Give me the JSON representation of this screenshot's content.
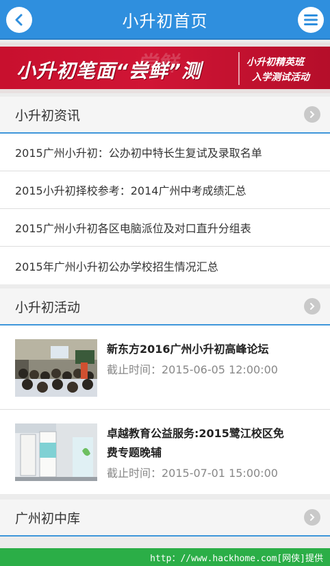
{
  "header": {
    "title": "小升初首页",
    "back_icon": "chevron-left-icon",
    "menu_icon": "menu-icon"
  },
  "banner": {
    "main_text": "小升初笔面“尝鲜”测",
    "ghost_text": "尝鲜",
    "sub_line1": "小升初精英班",
    "sub_line2": "入学测试活动"
  },
  "news": {
    "title": "小升初资讯",
    "items": [
      "2015广州小升初：公办初中特长生复试及录取名单",
      "2015小升初择校参考：2014广州中考成绩汇总",
      "2015广州小升初各区电脑派位及对口直升分组表",
      "2015年广州小升初公办学校招生情况汇总"
    ]
  },
  "activities": {
    "title": "小升初活动",
    "items": [
      {
        "title_line1": "新东方2016广州小升初高峰论坛",
        "title_line2": "",
        "deadline": "截止时间：2015-06-05 12:00:00"
      },
      {
        "title_line1": "卓越教育公益服务:2015鹭江校区免",
        "title_line2": "费专题晚辅",
        "deadline": "截止时间：2015-07-01 15:00:00"
      }
    ]
  },
  "schools": {
    "title": "广州初中库"
  },
  "watermark": "http：//www.hackhome.com[网侠]提供",
  "colors": {
    "header_blue": "#2f8fde",
    "banner_red": "#c8102e",
    "divider_blue": "#3e96da",
    "watermark_green": "#2bae47"
  }
}
